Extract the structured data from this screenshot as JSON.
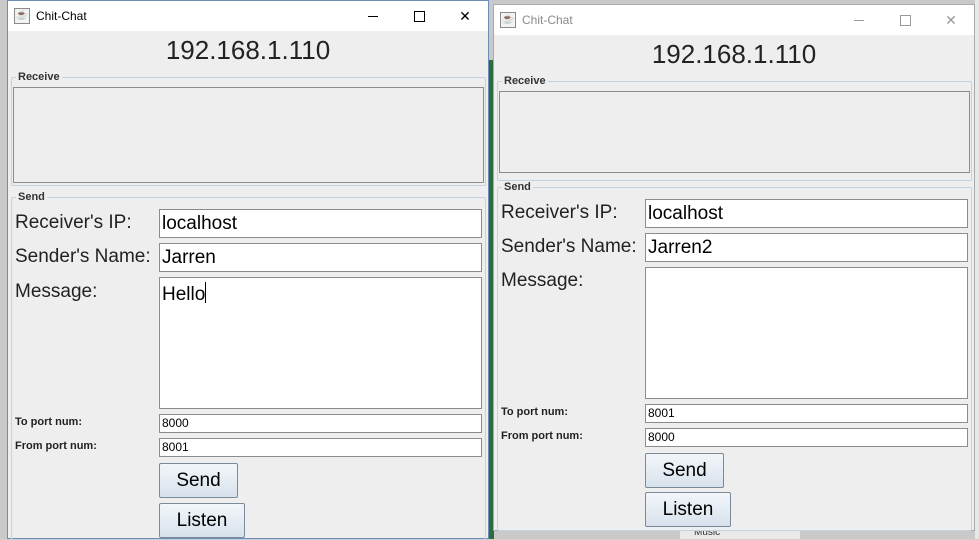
{
  "background": {
    "taskbar_item": "Music"
  },
  "windows": [
    {
      "title": "Chit-Chat",
      "active": true,
      "ip": "192.168.1.110",
      "receive_legend": "Receive",
      "send_legend": "Send",
      "receiver_ip_label": "Receiver's IP:",
      "receiver_ip_value": "localhost",
      "sender_name_label": "Sender's Name:",
      "sender_name_value": "Jarren",
      "message_label": "Message:",
      "message_value": "Hello",
      "to_port_label": "To port num:",
      "to_port_value": "8000",
      "from_port_label": "From port num:",
      "from_port_value": "8001",
      "send_button": "Send",
      "listen_button": "Listen"
    },
    {
      "title": "Chit-Chat",
      "active": false,
      "ip": "192.168.1.110",
      "receive_legend": "Receive",
      "send_legend": "Send",
      "receiver_ip_label": "Receiver's IP:",
      "receiver_ip_value": "localhost",
      "sender_name_label": "Sender's Name:",
      "sender_name_value": "Jarren2",
      "message_label": "Message:",
      "message_value": "",
      "to_port_label": "To port num:",
      "to_port_value": "8001",
      "from_port_label": "From port num:",
      "from_port_value": "8000",
      "send_button": "Send",
      "listen_button": "Listen"
    }
  ],
  "icons": {
    "app": "java-cup-icon",
    "minimize": "minimize-icon",
    "maximize": "maximize-icon",
    "close": "close-icon"
  }
}
